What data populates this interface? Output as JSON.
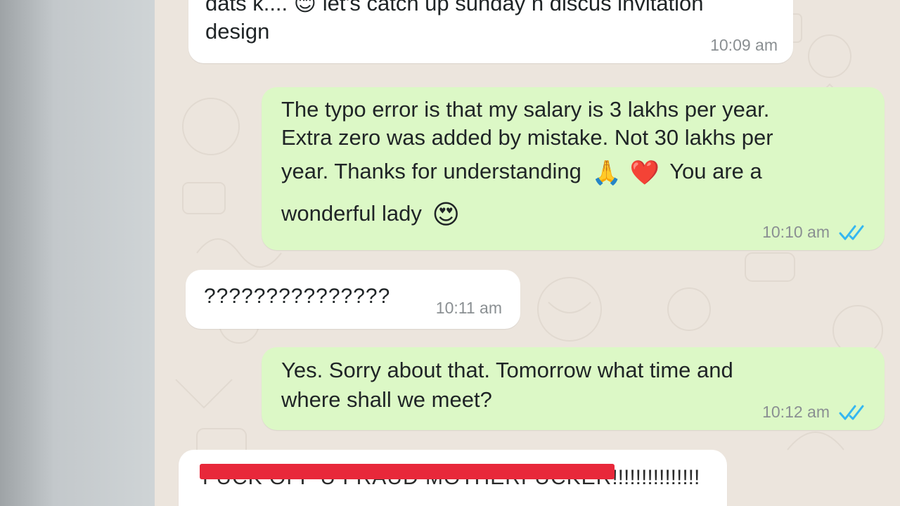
{
  "messages": [
    {
      "id": "m1",
      "direction": "incoming",
      "line1": "dats k.... 😊 let's catch up sunday n discus invitation",
      "line2": "design",
      "time": "10:09 am"
    },
    {
      "id": "m2",
      "direction": "outgoing",
      "line1": "The typo error is that my salary is 3 lakhs per year.",
      "line2": "Extra zero was added by mistake. Not 30 lakhs per",
      "line3_a": "year. Thanks for understanding",
      "line3_b": "You are a",
      "line4": "wonderful lady",
      "emoji_pray": "🙏",
      "emoji_heart": "❤️",
      "emoji_hearteyes": "😍",
      "time": "10:10 am",
      "status": "read"
    },
    {
      "id": "m3",
      "direction": "incoming",
      "text": "???????????????",
      "time": "10:11 am"
    },
    {
      "id": "m4",
      "direction": "outgoing",
      "line1": "Yes. Sorry about that. Tomorrow what time and",
      "line2": "where shall we meet?",
      "time": "10:12 am",
      "status": "read"
    },
    {
      "id": "m5",
      "direction": "incoming",
      "redacted_text": "FUCK OFF U FRAUD MOTHERFUCKER",
      "trailing": "!!!!!!!!!!!!!!!"
    }
  ],
  "colors": {
    "incoming_bubble": "#ffffff",
    "outgoing_bubble": "#dcf8c6",
    "chat_background": "#ece5dd",
    "read_ticks": "#34b7f1",
    "redaction": "#e8283a"
  },
  "icons": {
    "read_receipt": "double-check-icon"
  }
}
